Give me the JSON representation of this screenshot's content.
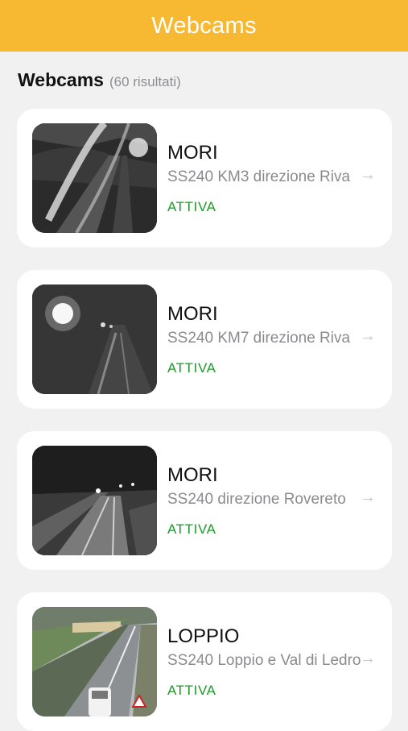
{
  "header": {
    "title": "Webcams"
  },
  "section": {
    "title": "Webcams",
    "count": "(60 risultati)"
  },
  "webcams": [
    {
      "location": "MORI",
      "road": "SS240 KM3 direzione Riva",
      "status": "ATTIVA"
    },
    {
      "location": "MORI",
      "road": "SS240 KM7 direzione Riva",
      "status": "ATTIVA"
    },
    {
      "location": "MORI",
      "road": "SS240 direzione Rovereto",
      "status": "ATTIVA"
    },
    {
      "location": "LOPPIO",
      "road": "SS240 Loppio e Val di Ledro",
      "status": "ATTIVA"
    }
  ],
  "colors": {
    "accent": "#f8b932",
    "status_active": "#1f9a2b",
    "background": "#f1f1f2"
  }
}
